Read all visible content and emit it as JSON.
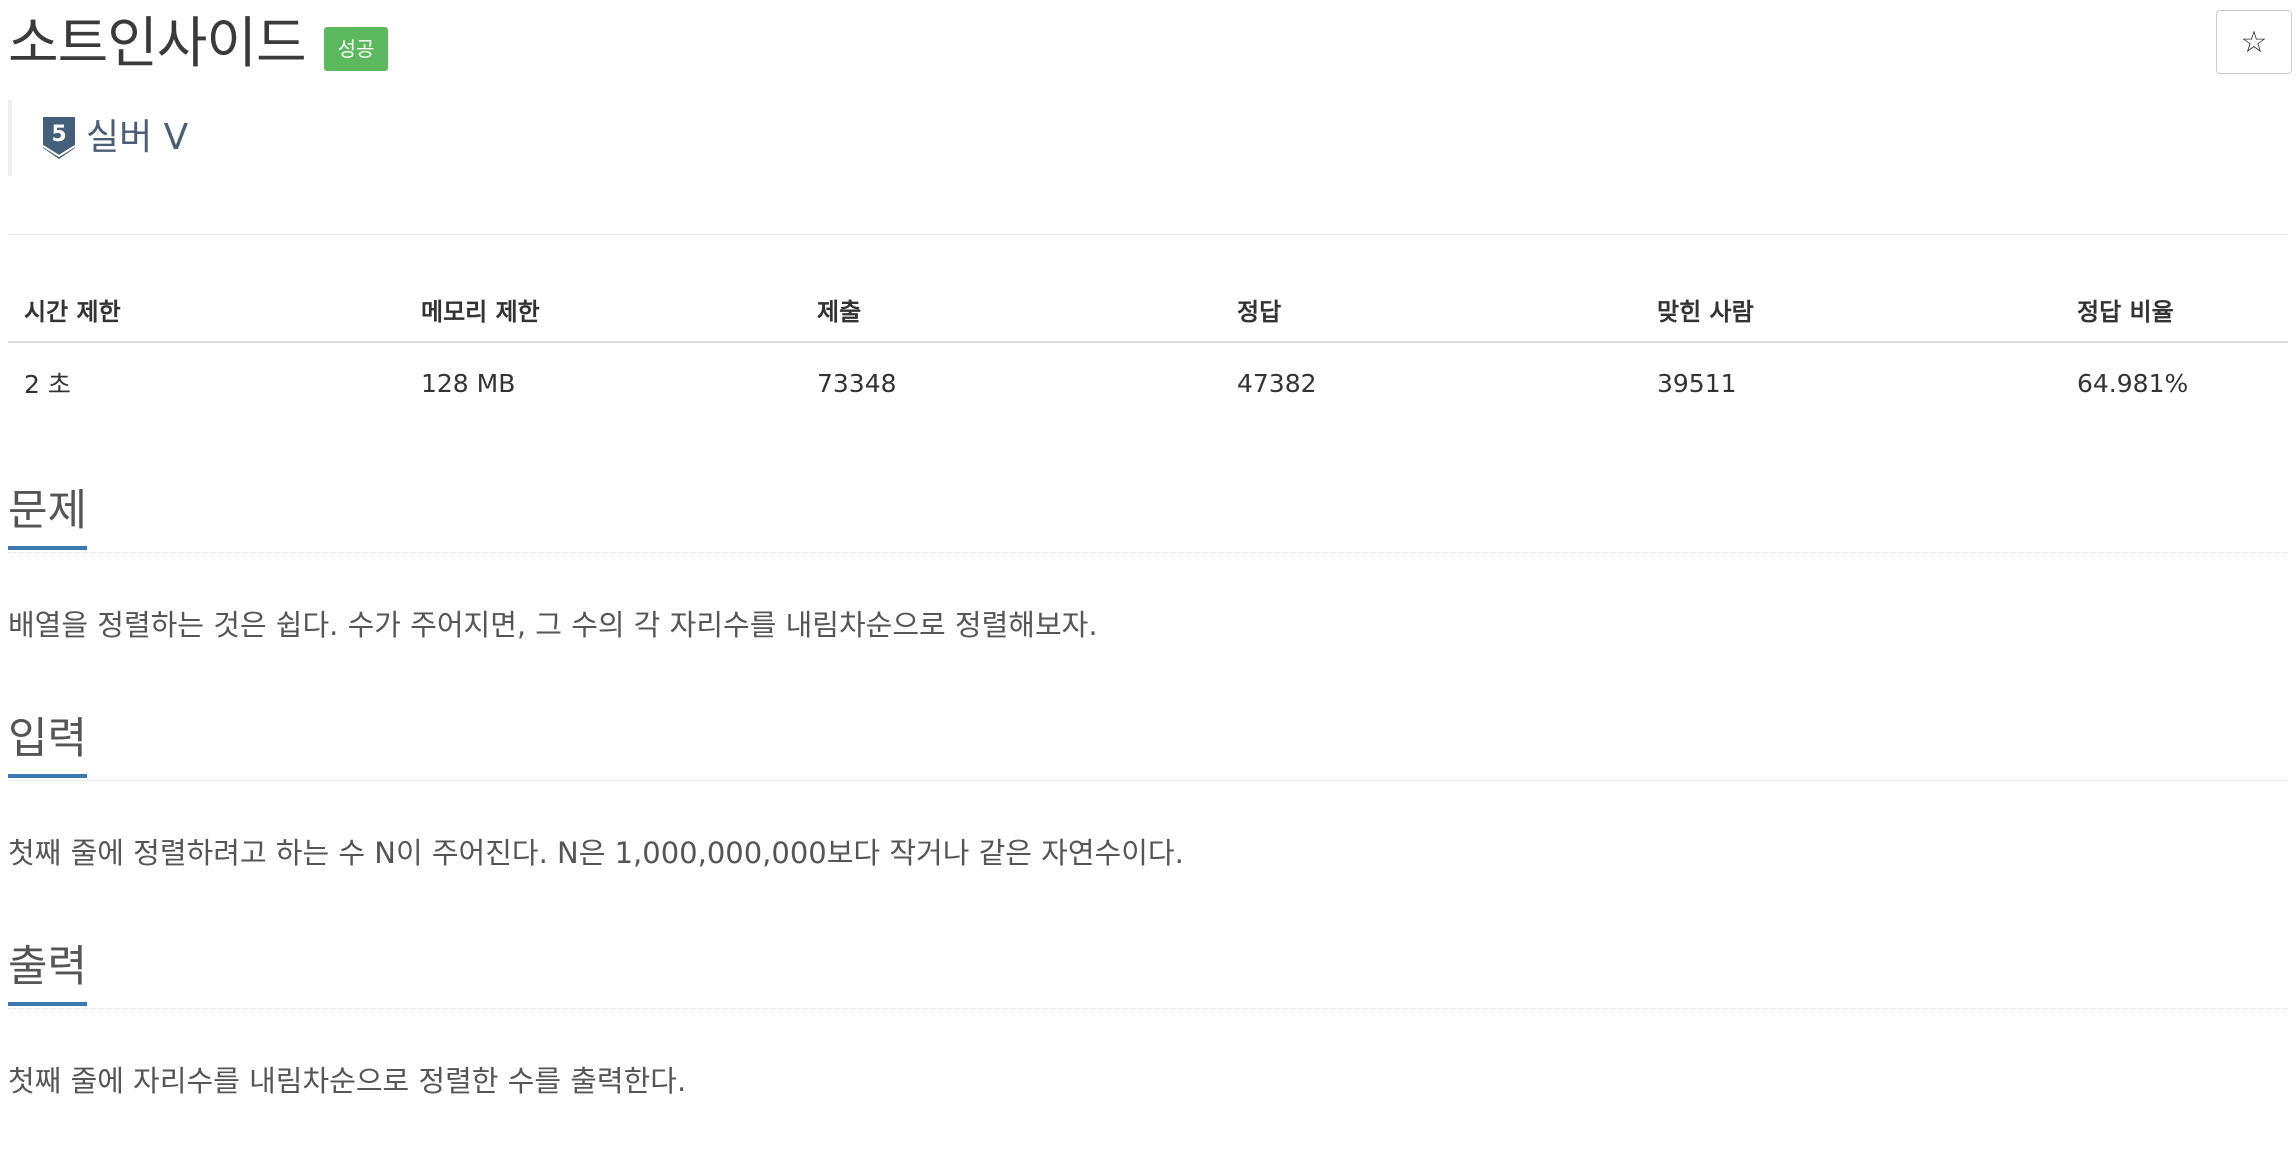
{
  "problem": {
    "title": "소트인사이드",
    "result_badge": "성공",
    "tier_icon_number": "5",
    "tier_label": "실버 V"
  },
  "actions": {
    "star_icon": "☆"
  },
  "colors": {
    "accent": "#3c78b4",
    "badge": "#5cb85c",
    "tier": "#435f7a"
  },
  "info_table": {
    "headers": [
      "시간 제한",
      "메모리 제한",
      "제출",
      "정답",
      "맞힌 사람",
      "정답 비율"
    ],
    "row": [
      "2 초",
      "128 MB",
      "73348",
      "47382",
      "39511",
      "64.981%"
    ]
  },
  "sections": [
    {
      "heading": "문제",
      "text": "배열을 정렬하는 것은 쉽다. 수가 주어지면, 그 수의 각 자리수를 내림차순으로 정렬해보자."
    },
    {
      "heading": "입력",
      "text": "첫째 줄에 정렬하려고 하는 수 N이 주어진다. N은 1,000,000,000보다 작거나 같은 자연수이다."
    },
    {
      "heading": "출력",
      "text": "첫째 줄에 자리수를 내림차순으로 정렬한 수를 출력한다."
    }
  ]
}
